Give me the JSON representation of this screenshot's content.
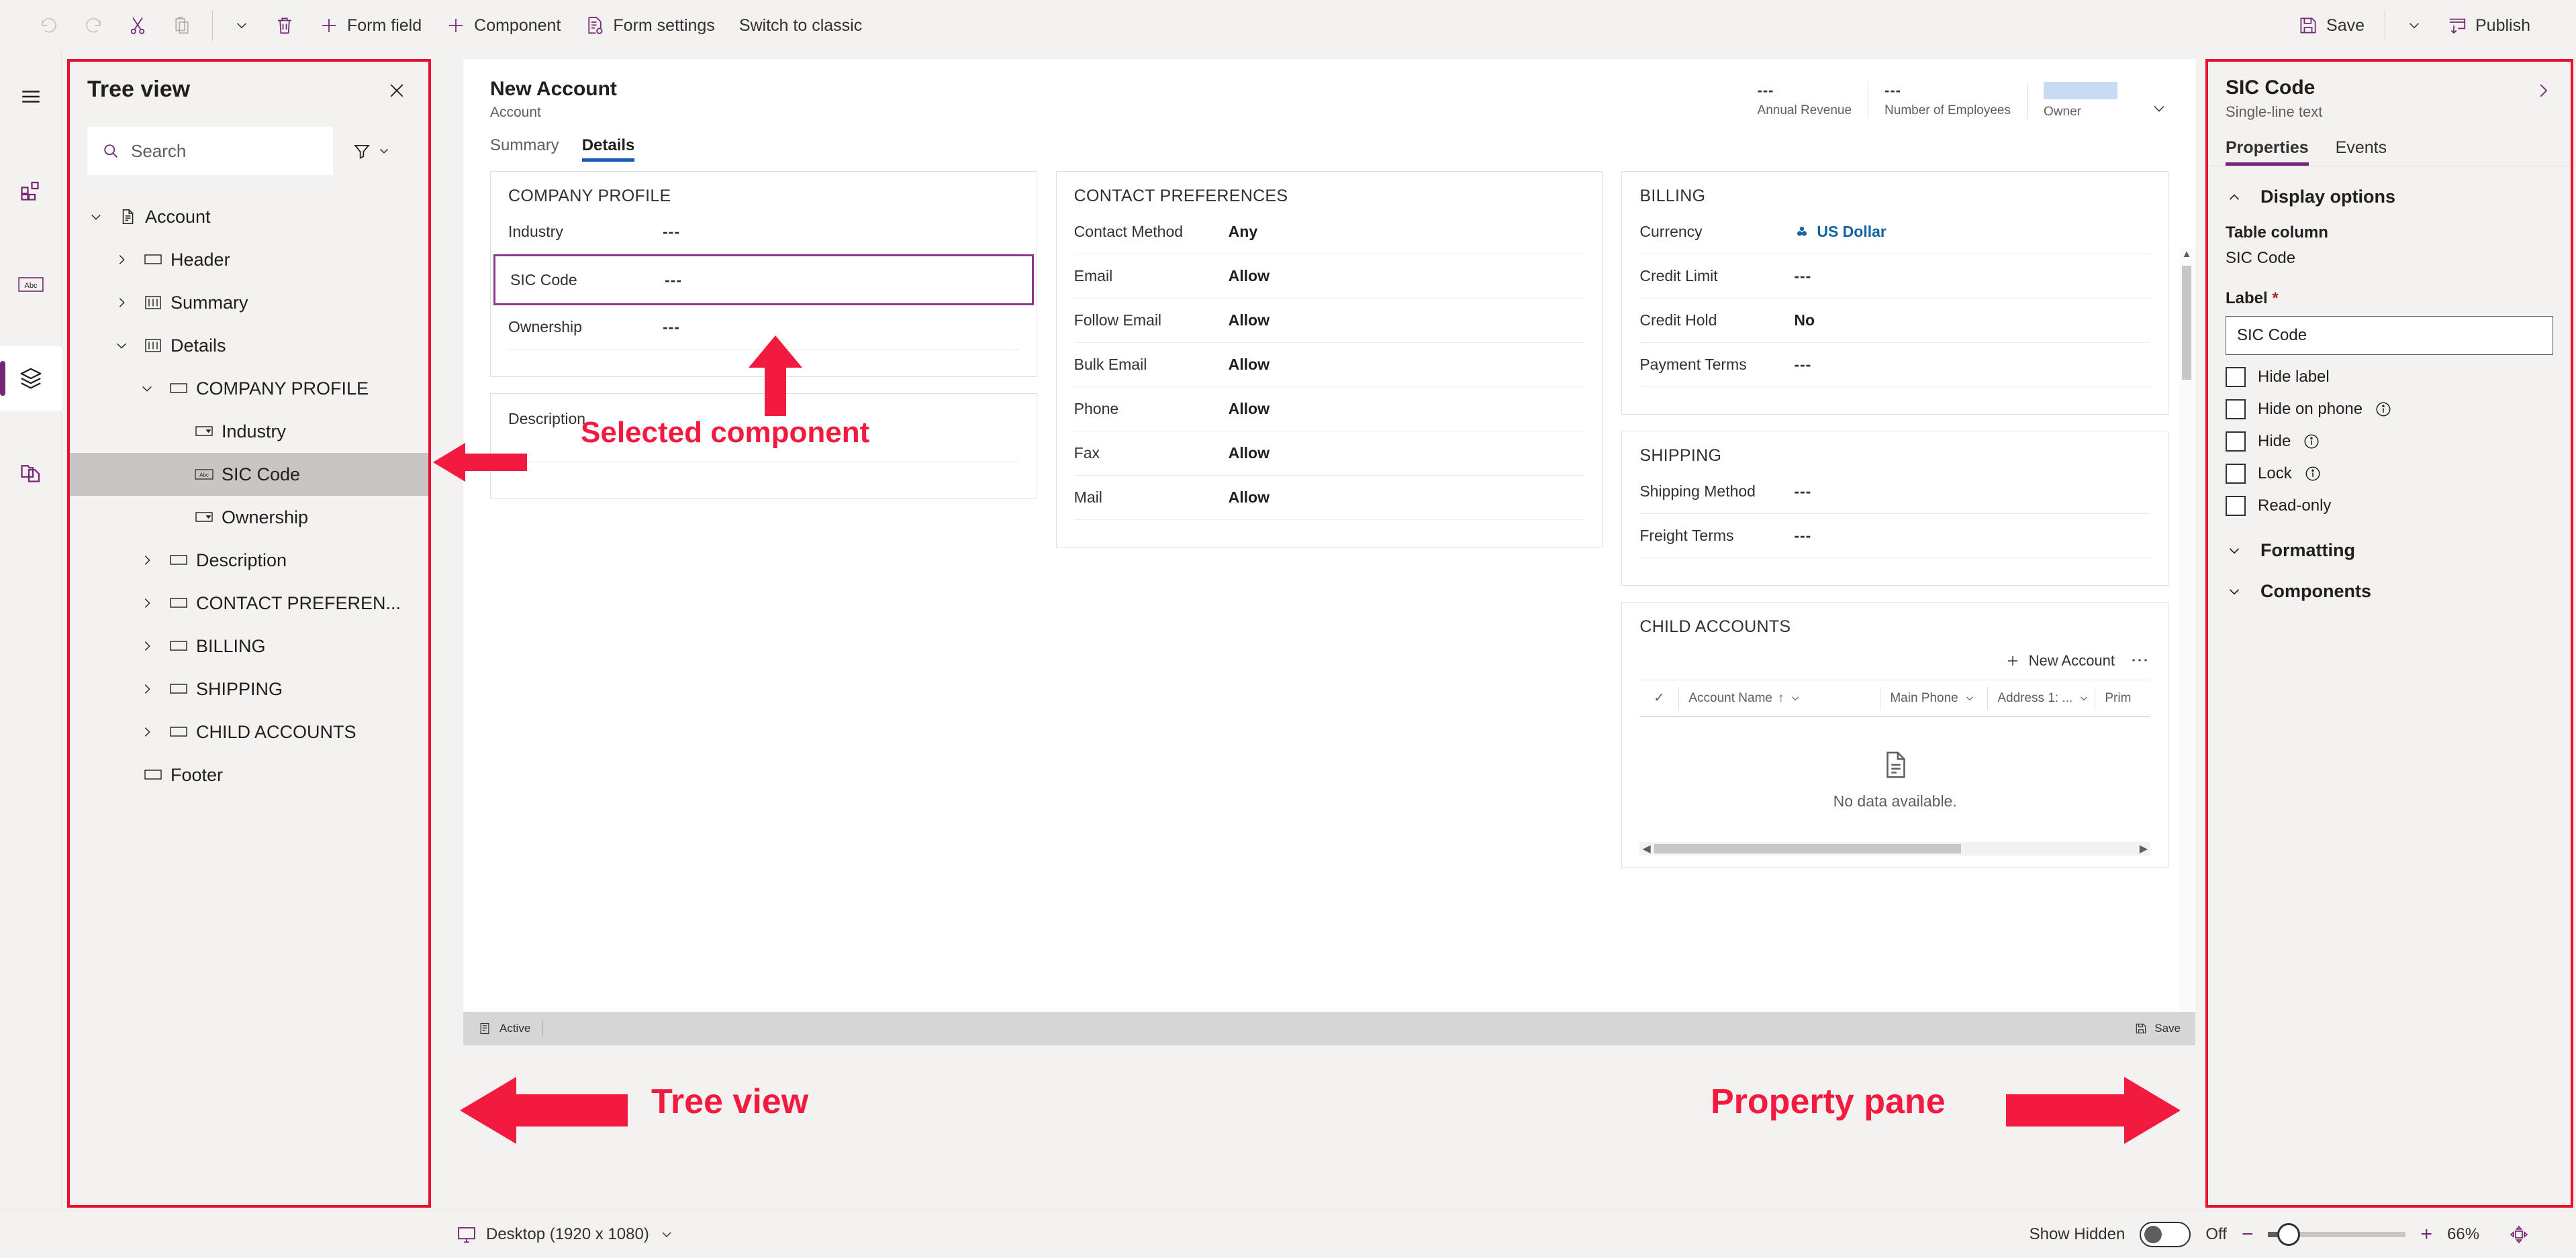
{
  "toolbar": {
    "undo": "undo-icon",
    "redo": "redo-icon",
    "cut": "cut-icon",
    "paste": "paste-icon",
    "paste_chevron": "chevron-down-icon",
    "delete": "trash-icon",
    "form_field": "Form field",
    "component": "Component",
    "form_settings": "Form settings",
    "switch_classic": "Switch to classic",
    "save": "Save",
    "save_chevron": "chevron-down-icon",
    "publish": "Publish"
  },
  "rail": {
    "items": [
      {
        "icon": "hamburger-icon",
        "name": "menu"
      },
      {
        "icon": "components-icon",
        "name": "components"
      },
      {
        "icon": "abc-icon",
        "name": "table-columns"
      },
      {
        "icon": "layers-icon",
        "name": "tree-view"
      },
      {
        "icon": "copy-page-icon",
        "name": "form-library"
      }
    ]
  },
  "tree_view": {
    "title": "Tree view",
    "close_icon": "close-icon",
    "search": {
      "placeholder": "Search",
      "value": "",
      "icon": "search-icon"
    },
    "filter": {
      "icon": "filter-icon",
      "chevron": "chevron-down-icon"
    },
    "nodes": [
      {
        "label": "Account",
        "indent": 0,
        "chevron": "down",
        "icon": "form-icon",
        "selected": false
      },
      {
        "label": "Header",
        "indent": 1,
        "chevron": "right",
        "icon": "section-icon",
        "selected": false
      },
      {
        "label": "Summary",
        "indent": 1,
        "chevron": "right",
        "icon": "tab-icon",
        "selected": false
      },
      {
        "label": "Details",
        "indent": 1,
        "chevron": "down",
        "icon": "tab-icon",
        "selected": false
      },
      {
        "label": "COMPANY PROFILE",
        "indent": 2,
        "chevron": "down",
        "icon": "section-icon",
        "selected": false
      },
      {
        "label": "Industry",
        "indent": 3,
        "chevron": "none",
        "icon": "choice-icon",
        "selected": false
      },
      {
        "label": "SIC Code",
        "indent": 3,
        "chevron": "none",
        "icon": "abc-icon",
        "selected": true
      },
      {
        "label": "Ownership",
        "indent": 3,
        "chevron": "none",
        "icon": "choice-icon",
        "selected": false
      },
      {
        "label": "Description",
        "indent": 2,
        "chevron": "right",
        "icon": "section-icon",
        "selected": false
      },
      {
        "label": "CONTACT PREFEREN...",
        "indent": 2,
        "chevron": "right",
        "icon": "section-icon",
        "selected": false
      },
      {
        "label": "BILLING",
        "indent": 2,
        "chevron": "right",
        "icon": "section-icon",
        "selected": false
      },
      {
        "label": "SHIPPING",
        "indent": 2,
        "chevron": "right",
        "icon": "section-icon",
        "selected": false
      },
      {
        "label": "CHILD ACCOUNTS",
        "indent": 2,
        "chevron": "right",
        "icon": "section-icon",
        "selected": false
      },
      {
        "label": "Footer",
        "indent": 1,
        "chevron": "none",
        "icon": "section-icon",
        "selected": false
      }
    ]
  },
  "canvas": {
    "record_title": "New Account",
    "record_subtitle": "Account",
    "kpis": [
      {
        "value": "---",
        "label": "Annual Revenue"
      },
      {
        "value": "---",
        "label": "Number of Employees"
      },
      {
        "value": "",
        "label": "Owner"
      }
    ],
    "header_chevron": "chevron-down-icon",
    "tabs": [
      {
        "label": "Summary",
        "active": false
      },
      {
        "label": "Details",
        "active": true
      }
    ],
    "column1": {
      "company_profile": {
        "title": "COMPANY PROFILE",
        "fields": [
          {
            "label": "Industry",
            "value": "---",
            "selected": false
          },
          {
            "label": "SIC Code",
            "value": "---",
            "selected": true
          },
          {
            "label": "Ownership",
            "value": "---",
            "selected": false
          }
        ]
      },
      "description": {
        "title": "Description"
      }
    },
    "column2": {
      "contact_preferences": {
        "title": "CONTACT PREFERENCES",
        "fields": [
          {
            "label": "Contact Method",
            "value": "Any"
          },
          {
            "label": "Email",
            "value": "Allow"
          },
          {
            "label": "Follow Email",
            "value": "Allow"
          },
          {
            "label": "Bulk Email",
            "value": "Allow"
          },
          {
            "label": "Phone",
            "value": "Allow"
          },
          {
            "label": "Fax",
            "value": "Allow"
          },
          {
            "label": "Mail",
            "value": "Allow"
          }
        ]
      }
    },
    "column3": {
      "billing": {
        "title": "BILLING",
        "fields": [
          {
            "label": "Currency",
            "value": "US Dollar",
            "link": true
          },
          {
            "label": "Credit Limit",
            "value": "---"
          },
          {
            "label": "Credit Hold",
            "value": "No"
          },
          {
            "label": "Payment Terms",
            "value": "---"
          }
        ]
      },
      "shipping": {
        "title": "SHIPPING",
        "fields": [
          {
            "label": "Shipping Method",
            "value": "---"
          },
          {
            "label": "Freight Terms",
            "value": "---"
          }
        ]
      },
      "child_accounts": {
        "title": "CHILD ACCOUNTS",
        "new_button": "New Account",
        "more_icon": "more-vertical-icon",
        "columns": [
          {
            "label": "Account Name",
            "sort": "↑"
          },
          {
            "label": "Main Phone"
          },
          {
            "label": "Address 1: ..."
          },
          {
            "label": "Prim"
          }
        ],
        "empty_text": "No data available.",
        "empty_icon": "document-icon"
      }
    },
    "footer": {
      "status": "Active",
      "save": "Save",
      "status_icon": "record-icon",
      "save_icon": "save-icon"
    }
  },
  "property_pane": {
    "title": "SIC Code",
    "subtitle": "Single-line text",
    "collapse_icon": "chevron-right-icon",
    "tabs": [
      {
        "label": "Properties",
        "active": true
      },
      {
        "label": "Events",
        "active": false
      }
    ],
    "display_options": {
      "section_title": "Display options",
      "expanded": true,
      "table_column_label": "Table column",
      "table_column_value": "SIC Code",
      "label_label": "Label",
      "label_required": "*",
      "label_value": "SIC Code",
      "checkboxes": [
        {
          "label": "Hide label",
          "checked": false,
          "info": false
        },
        {
          "label": "Hide on phone",
          "checked": false,
          "info": true
        },
        {
          "label": "Hide",
          "checked": false,
          "info": true
        },
        {
          "label": "Lock",
          "checked": false,
          "info": true
        },
        {
          "label": "Read-only",
          "checked": false,
          "info": false
        }
      ]
    },
    "formatting": {
      "section_title": "Formatting",
      "expanded": false
    },
    "components": {
      "section_title": "Components",
      "expanded": false
    }
  },
  "bottom_bar": {
    "device": "Desktop (1920 x 1080)",
    "device_icon": "monitor-icon",
    "device_chevron": "chevron-down-icon",
    "show_hidden_label": "Show Hidden",
    "show_hidden_state": "Off",
    "zoom_minus": "−",
    "zoom_plus": "+",
    "zoom_level": "66%",
    "fit_icon": "fit-to-screen-icon"
  },
  "annotations": [
    {
      "text": "Selected component",
      "name": "annotation-selected-component"
    },
    {
      "text": "Tree view",
      "name": "annotation-tree-view"
    },
    {
      "text": "Property pane",
      "name": "annotation-property-pane"
    }
  ],
  "colors": {
    "accent": "#742774",
    "annotation_red": "#f21b3f",
    "selection_purple": "#8a3b8f",
    "tab_blue": "#185abd",
    "link_blue": "#1264a3"
  }
}
